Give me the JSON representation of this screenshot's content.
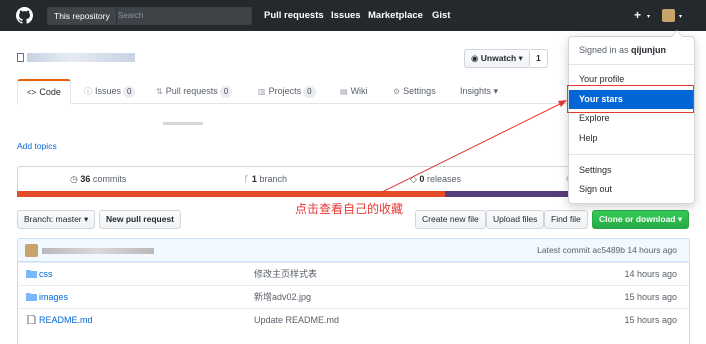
{
  "header": {
    "search_scope": "This repository",
    "search_placeholder": "Search",
    "nav": [
      "Pull requests",
      "Issues",
      "Marketplace",
      "Gist"
    ],
    "plus": "+",
    "caret": "▾"
  },
  "repo": {
    "watch_label": "Unwatch ▾",
    "watch_count": "1"
  },
  "tabs": {
    "code": "Code",
    "issues": "Issues",
    "issues_count": "0",
    "pulls": "Pull requests",
    "pulls_count": "0",
    "projects": "Projects",
    "projects_count": "0",
    "wiki": "Wiki",
    "settings": "Settings",
    "insights": "Insights ▾"
  },
  "add_topics": "Add topics",
  "summary": {
    "commits_num": "36",
    "commits_label": "commits",
    "branch_num": "1",
    "branch_label": "branch",
    "releases_num": "0",
    "releases_label": "releases"
  },
  "colors": {
    "lang_bar": [
      "#e34c26",
      "#563d7c"
    ]
  },
  "filenav": {
    "branch": "Branch: master ▾",
    "new_pr": "New pull request",
    "create": "Create new file",
    "upload": "Upload files",
    "find": "Find file",
    "clone": "Clone or download ▾"
  },
  "commit": {
    "latest": "Latest commit ac5489b 14 hours ago"
  },
  "files": [
    {
      "name": "css",
      "message": "修改主页样式表",
      "age": "14 hours ago",
      "type": "folder"
    },
    {
      "name": "images",
      "message": "新增adv02.jpg",
      "age": "15 hours ago",
      "type": "folder"
    },
    {
      "name": "README.md",
      "message": "Update README.md",
      "age": "15 hours ago",
      "type": "file"
    }
  ],
  "dropdown": {
    "signed_in_prefix": "Signed in as ",
    "username": "qijunjun",
    "profile": "Your profile",
    "stars": "Your stars",
    "explore": "Explore",
    "help": "Help",
    "settings": "Settings",
    "signout": "Sign out"
  },
  "annotation": "点击查看自己的收藏"
}
